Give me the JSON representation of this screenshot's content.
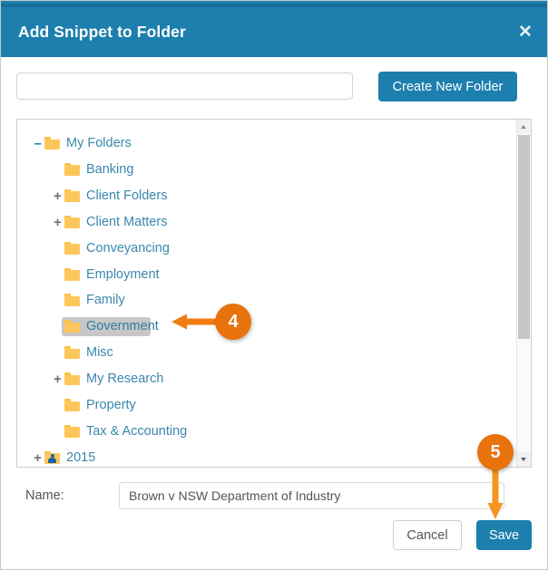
{
  "dialog": {
    "title": "Add Snippet to Folder",
    "close_icon": "close-icon",
    "accent_color": "#1c7fad",
    "callout_color": "#e8720c"
  },
  "new_folder": {
    "input_value": "",
    "input_placeholder": "",
    "button_label": "Create New Folder"
  },
  "tree": {
    "items": [
      {
        "label": "My Folders",
        "toggle": "-",
        "icon": "folder-icon",
        "depth": 0,
        "selected": false
      },
      {
        "label": "Banking",
        "toggle": "",
        "icon": "folder-icon",
        "depth": 1,
        "selected": false
      },
      {
        "label": "Client Folders",
        "toggle": "+",
        "icon": "folder-icon",
        "depth": 1,
        "selected": false
      },
      {
        "label": "Client Matters",
        "toggle": "+",
        "icon": "folder-icon",
        "depth": 1,
        "selected": false
      },
      {
        "label": "Conveyancing",
        "toggle": "",
        "icon": "folder-icon",
        "depth": 1,
        "selected": false
      },
      {
        "label": "Employment",
        "toggle": "",
        "icon": "folder-icon",
        "depth": 1,
        "selected": false
      },
      {
        "label": "Family",
        "toggle": "",
        "icon": "folder-icon",
        "depth": 1,
        "selected": false
      },
      {
        "label": "Government",
        "toggle": "",
        "icon": "folder-icon",
        "depth": 1,
        "selected": true
      },
      {
        "label": "Misc",
        "toggle": "",
        "icon": "folder-icon",
        "depth": 1,
        "selected": false
      },
      {
        "label": "My Research",
        "toggle": "+",
        "icon": "folder-icon",
        "depth": 1,
        "selected": false
      },
      {
        "label": "Property",
        "toggle": "",
        "icon": "folder-icon",
        "depth": 1,
        "selected": false
      },
      {
        "label": "Tax & Accounting",
        "toggle": "",
        "icon": "folder-icon",
        "depth": 1,
        "selected": false
      },
      {
        "label": "2015",
        "toggle": "+",
        "icon": "shared-folder-icon",
        "depth": 0,
        "selected": false
      }
    ],
    "scrollbar": {
      "up_icon": "scroll-up-arrow-icon",
      "down_icon": "scroll-down-arrow-icon",
      "thumb_position_pct": 0
    }
  },
  "name_field": {
    "label": "Name:",
    "value": "Brown v NSW Department of Industry",
    "placeholder": ""
  },
  "footer": {
    "cancel_label": "Cancel",
    "save_label": "Save"
  },
  "callouts": [
    {
      "number": "4",
      "points_to": "Government"
    },
    {
      "number": "5",
      "points_to": "Save"
    }
  ]
}
